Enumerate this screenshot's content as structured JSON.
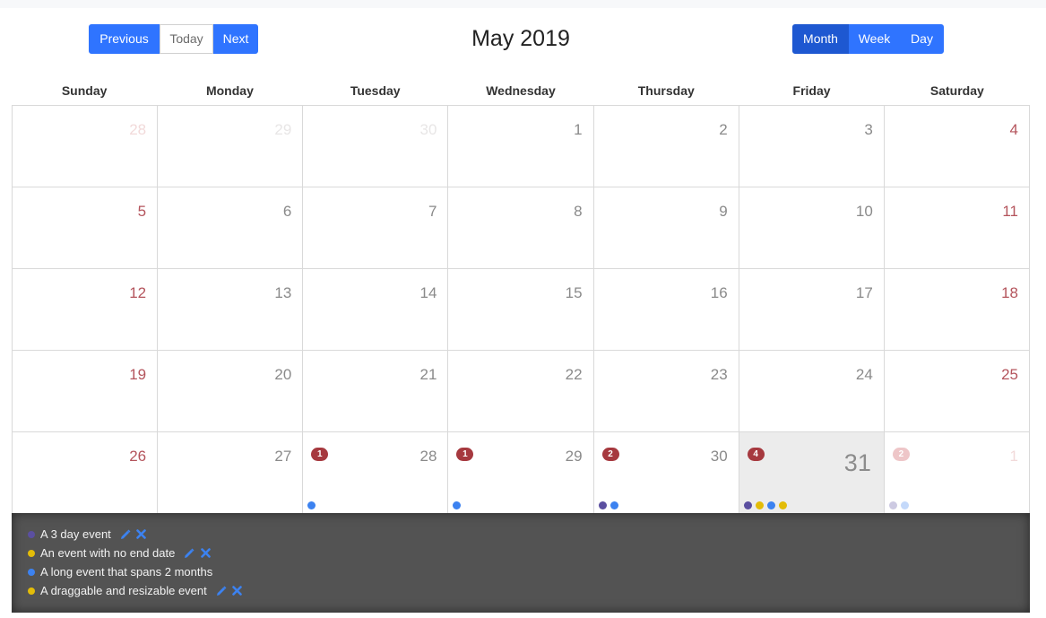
{
  "toolbar": {
    "previous_label": "Previous",
    "today_label": "Today",
    "next_label": "Next",
    "title": "May 2019",
    "month_label": "Month",
    "week_label": "Week",
    "day_label": "Day",
    "active_view": "Month"
  },
  "weekdays": [
    "Sunday",
    "Monday",
    "Tuesday",
    "Wednesday",
    "Thursday",
    "Friday",
    "Saturday"
  ],
  "colors": {
    "primary": "#2f74ff",
    "primary_active": "#1e58d1",
    "weekend_text": "#b4545c",
    "badge": "#a6393f",
    "event_purple": "#5b4fa0",
    "event_yellow": "#e3bc08",
    "event_blue": "#3c82f0",
    "panel_bg": "#535353"
  },
  "weeks": [
    [
      {
        "day": "28",
        "outside": true,
        "weekend": true
      },
      {
        "day": "29",
        "outside": true
      },
      {
        "day": "30",
        "outside": true
      },
      {
        "day": "1"
      },
      {
        "day": "2"
      },
      {
        "day": "3"
      },
      {
        "day": "4",
        "weekend": true
      }
    ],
    [
      {
        "day": "5",
        "weekend": true
      },
      {
        "day": "6"
      },
      {
        "day": "7"
      },
      {
        "day": "8"
      },
      {
        "day": "9"
      },
      {
        "day": "10"
      },
      {
        "day": "11",
        "weekend": true
      }
    ],
    [
      {
        "day": "12",
        "weekend": true
      },
      {
        "day": "13"
      },
      {
        "day": "14"
      },
      {
        "day": "15"
      },
      {
        "day": "16"
      },
      {
        "day": "17"
      },
      {
        "day": "18",
        "weekend": true
      }
    ],
    [
      {
        "day": "19",
        "weekend": true
      },
      {
        "day": "20"
      },
      {
        "day": "21"
      },
      {
        "day": "22"
      },
      {
        "day": "23"
      },
      {
        "day": "24"
      },
      {
        "day": "25",
        "weekend": true
      }
    ],
    [
      {
        "day": "26",
        "weekend": true
      },
      {
        "day": "27"
      },
      {
        "day": "28",
        "badge": "1",
        "dots": [
          "blue"
        ]
      },
      {
        "day": "29",
        "badge": "1",
        "dots": [
          "blue"
        ]
      },
      {
        "day": "30",
        "badge": "2",
        "dots": [
          "purple",
          "blue"
        ]
      },
      {
        "day": "31",
        "badge": "4",
        "today": true,
        "dots": [
          "purple",
          "yellow",
          "blue",
          "yellow"
        ]
      },
      {
        "day": "1",
        "outside": true,
        "weekend": true,
        "badge": "2",
        "dots": [
          "purple",
          "blue"
        ]
      }
    ]
  ],
  "events": [
    {
      "label": "A 3 day event",
      "color": "purple",
      "actions": true
    },
    {
      "label": "An event with no end date",
      "color": "yellow",
      "actions": true
    },
    {
      "label": "A long event that spans 2 months",
      "color": "blue",
      "actions": false
    },
    {
      "label": "A draggable and resizable event",
      "color": "yellow",
      "actions": true
    }
  ],
  "icons": {
    "edit": "pencil-icon",
    "delete": "cross-icon"
  }
}
